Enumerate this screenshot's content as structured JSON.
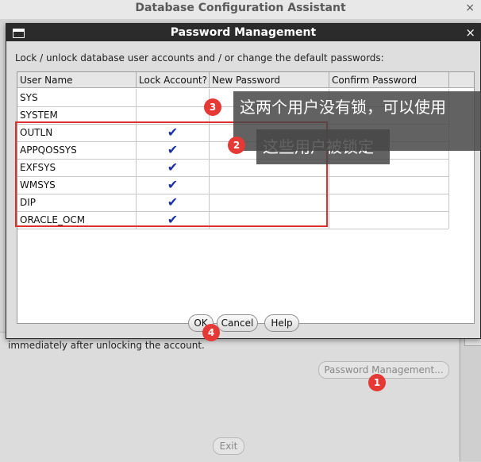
{
  "app": {
    "title": "Database Configuration Assistant",
    "close": "×"
  },
  "background": {
    "info_text": "immediately after unlocking the account.",
    "password_management_button": "Password Management...",
    "exit_button": "Exit"
  },
  "dialog": {
    "title": "Password Management",
    "close": "×",
    "instruction": "Lock / unlock database user accounts and / or change the default passwords:",
    "columns": [
      "User Name",
      "Lock Account?",
      "New Password",
      "Confirm Password"
    ],
    "rows": [
      {
        "user": "SYS",
        "locked": ""
      },
      {
        "user": "SYSTEM",
        "locked": ""
      },
      {
        "user": "OUTLN",
        "locked": "✔"
      },
      {
        "user": "APPQOSSYS",
        "locked": "✔"
      },
      {
        "user": "EXFSYS",
        "locked": "✔"
      },
      {
        "user": "WMSYS",
        "locked": "✔"
      },
      {
        "user": "DIP",
        "locked": "✔"
      },
      {
        "user": "ORACLE_OCM",
        "locked": "✔"
      }
    ],
    "buttons": {
      "ok": "OK",
      "cancel": "Cancel",
      "help": "Help"
    }
  },
  "annotations": {
    "note3": "这两个用户没有锁，可以使用",
    "note2": "这些用户被锁定",
    "badges": [
      "1",
      "2",
      "3",
      "4"
    ]
  },
  "colors": {
    "annotation_red": "#e53935",
    "check_blue": "#1a2fa8"
  }
}
